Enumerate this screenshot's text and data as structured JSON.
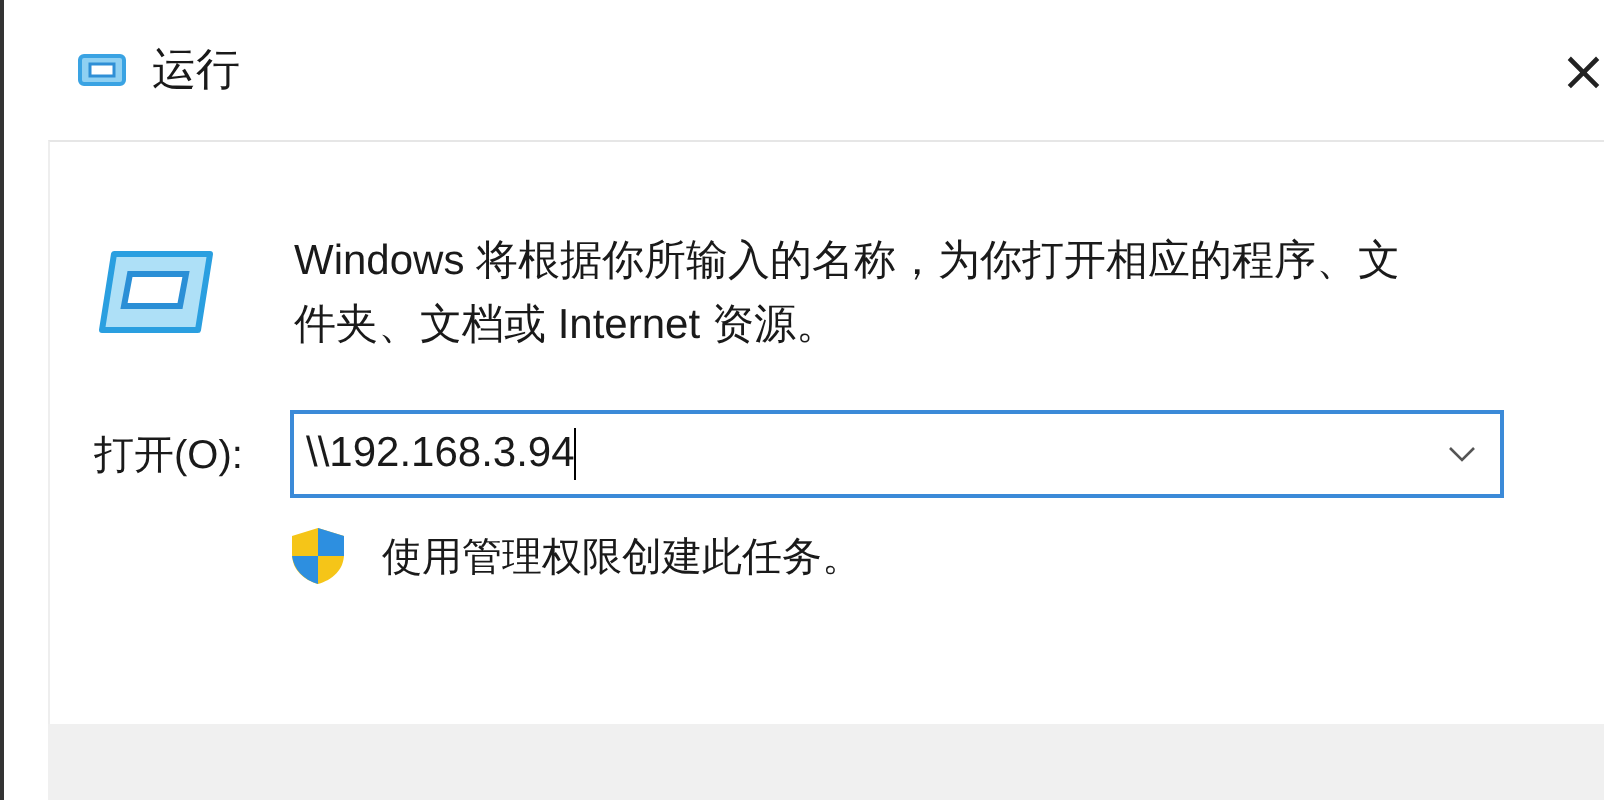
{
  "window": {
    "title": "运行",
    "close": "×"
  },
  "description": "Windows 将根据你所输入的名称，为你打开相应的程序、文件夹、文档或 Internet 资源。",
  "open_field": {
    "label": "打开(O):",
    "value": "\\\\192.168.3.94",
    "focused": true
  },
  "admin_note": "使用管理权限创建此任务。"
}
